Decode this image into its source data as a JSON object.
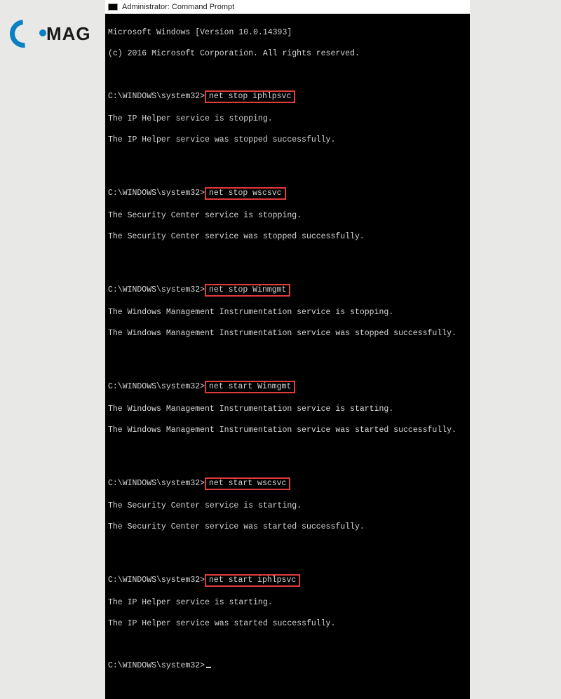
{
  "logo": {
    "text": "MAG"
  },
  "titlebar": {
    "icon_name": "cmd-icon",
    "title": "Administrator: Command Prompt"
  },
  "header": {
    "version_line": "Microsoft Windows [Version 10.0.14393]",
    "copyright_line": "(c) 2016 Microsoft Corporation. All rights reserved."
  },
  "prompt": "C:\\WINDOWS\\system32>",
  "blocks": [
    {
      "command": "net stop iphlpsvc",
      "out1": "The IP Helper service is stopping.",
      "out2": "The IP Helper service was stopped successfully."
    },
    {
      "command": "net stop wscsvc",
      "out1": "The Security Center service is stopping.",
      "out2": "The Security Center service was stopped successfully."
    },
    {
      "command": "net stop Winmgmt",
      "out1": "The Windows Management Instrumentation service is stopping.",
      "out2": "The Windows Management Instrumentation service was stopped successfully."
    },
    {
      "command": "net start Winmgmt",
      "out1": "The Windows Management Instrumentation service is starting.",
      "out2": "The Windows Management Instrumentation service was started successfully."
    },
    {
      "command": "net start wscsvc",
      "out1": "The Security Center service is starting.",
      "out2": "The Security Center service was started successfully."
    },
    {
      "command": "net start iphlpsvc",
      "out1": "The IP Helper service is starting.",
      "out2": "The IP Helper service was started successfully."
    }
  ]
}
